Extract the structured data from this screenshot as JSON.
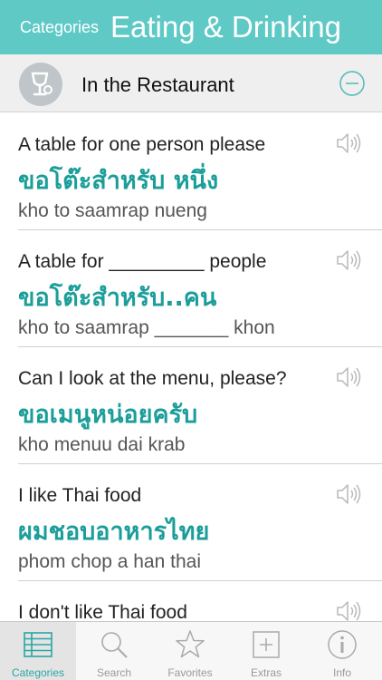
{
  "header": {
    "back_label": "Categories",
    "title": "Eating & Drinking"
  },
  "section": {
    "label": "In the Restaurant",
    "icon": "wine-glass-icon",
    "action_icon": "collapse-minus-icon"
  },
  "phrases": [
    {
      "english": "A table for one person please",
      "thai": "ขอโต๊ะสำหรับ หนึ่ง",
      "translit": "kho to saamrap nueng"
    },
    {
      "english": "A table for _________ people",
      "thai": "ขอโต๊ะสำหรับ..คน",
      "translit": "kho to saamrap _______ khon"
    },
    {
      "english": "Can I look at the menu, please?",
      "thai": "ขอเมนูหน่อยครับ",
      "translit": "kho menuu dai krab"
    },
    {
      "english": "I like Thai food",
      "thai": "ผมชอบอาหารไทย",
      "translit": "phom chop a han thai"
    },
    {
      "english": "I don't like Thai food",
      "thai": "",
      "translit": ""
    }
  ],
  "tabs": [
    {
      "label": "Categories",
      "icon": "categories-list-icon",
      "active": true
    },
    {
      "label": "Search",
      "icon": "search-icon",
      "active": false
    },
    {
      "label": "Favorites",
      "icon": "star-icon",
      "active": false
    },
    {
      "label": "Extras",
      "icon": "plus-box-icon",
      "active": false
    },
    {
      "label": "Info",
      "icon": "info-icon",
      "active": false
    }
  ],
  "colors": {
    "accent": "#5fc9c6",
    "thai_text": "#1b9e9a",
    "active_tab": "#2aa6a3"
  }
}
